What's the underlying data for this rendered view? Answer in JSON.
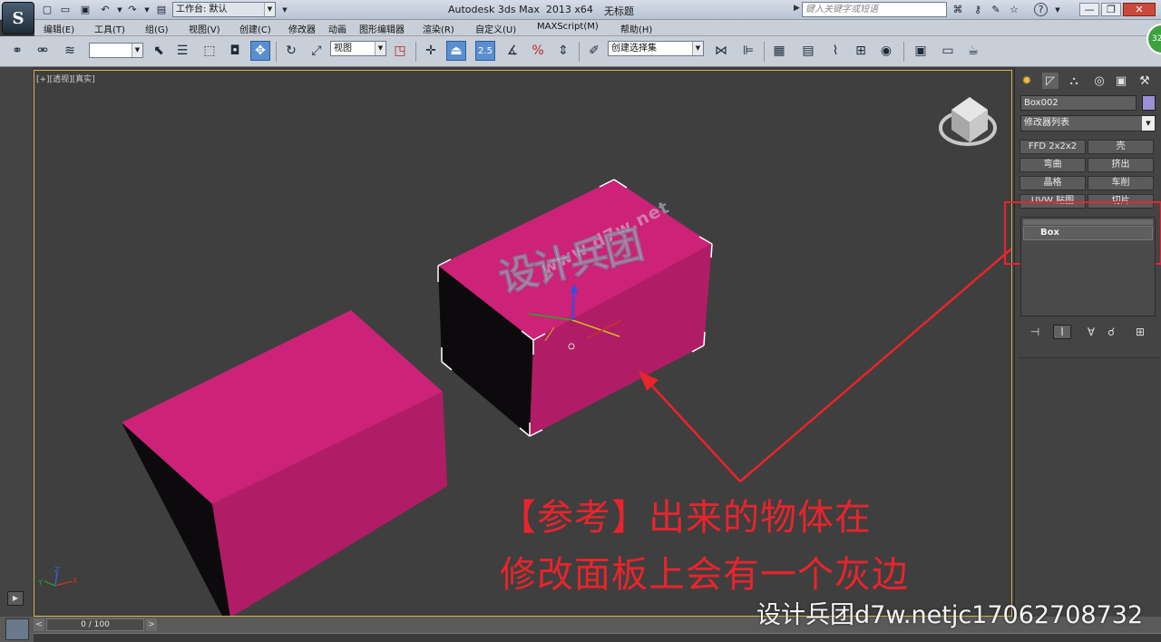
{
  "titlebar": {
    "workspace_label": "工作台: 默认",
    "app_title": "Autodesk 3ds Max  2013 x64",
    "doc_title": "无标题",
    "search_placeholder": "键入关键字或短语"
  },
  "menus": [
    "编辑(E)",
    "工具(T)",
    "组(G)",
    "视图(V)",
    "创建(C)",
    "修改器",
    "动画",
    "图形编辑器",
    "渲染(R)",
    "自定义(U)",
    "MAXScript(M)",
    "帮助(H)"
  ],
  "toolbar": {
    "selection_filter": "",
    "ref_coord": "视图",
    "snap_label": "2.5",
    "named_selection": "创建选择集"
  },
  "viewport": {
    "label_plus": "[+]",
    "label_view": "[透视]",
    "label_shading": "[真实]",
    "axis_x": "X",
    "axis_y": "Y",
    "axis_z": "Z",
    "watermark_url": "www.d7w.net",
    "watermark_logo": "设计兵团"
  },
  "annotation": {
    "line1": "【参考】出来的物体在",
    "line2": "修改面板上会有一个灰边",
    "color": "#e8242c"
  },
  "footer_watermark": "设计兵团d7w.netjc17062708732",
  "command_panel": {
    "object_name": "Box002",
    "object_color": "#9b8fd6",
    "modifier_list": "修改器列表",
    "modifier_buttons": [
      [
        "FFD 2x2x2",
        "壳"
      ],
      [
        "弯曲",
        "挤出"
      ],
      [
        "晶格",
        "车削"
      ],
      [
        "UVW 贴图",
        "切片"
      ]
    ],
    "stack_item": "Box"
  },
  "timeline": {
    "frame_label": "0 / 100"
  },
  "badge": "32",
  "colors": {
    "object_magenta": "#cc2277",
    "viewport_border": "#d4b44a"
  }
}
